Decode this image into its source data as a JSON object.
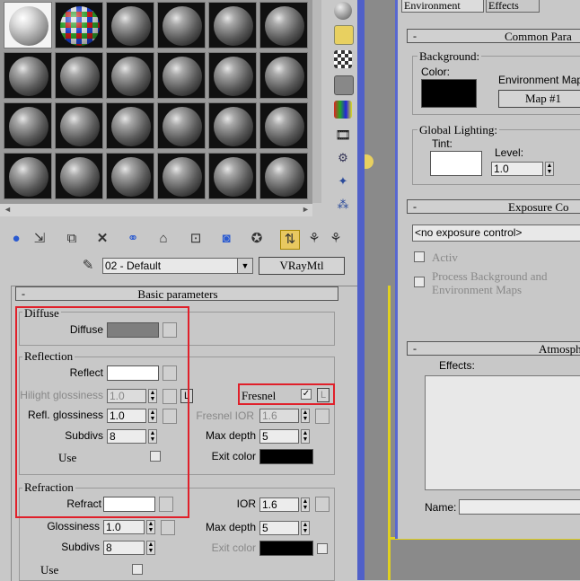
{
  "material_editor": {
    "toolbar_icons": [
      "get-material-icon",
      "put-to-scene-icon",
      "assign-material-icon",
      "delete-icon",
      "make-unique-icon",
      "put-to-library-icon",
      "material-effects-icon",
      "show-map-icon",
      "show-end-result-icon",
      "go-to-parent-icon",
      "go-sibling-icon"
    ],
    "side_icons": [
      "sample-type-icon",
      "backlight-icon",
      "checker-background-icon",
      "sample-uv-icon",
      "video-color-check-icon",
      "make-preview-icon",
      "options-icon",
      "select-by-material-icon",
      "material-navigator-icon"
    ],
    "material_name": "02 - Default",
    "material_type": "VRayMtl",
    "rollout_title": "Basic parameters",
    "diffuse": {
      "group": "Diffuse",
      "label": "Diffuse",
      "color": "#7e7e7e"
    },
    "reflection": {
      "group": "Reflection",
      "reflect_label": "Reflect",
      "reflect_color": "#ffffff",
      "hilight_label": "Hilight glossiness",
      "hilight_value": "1.0",
      "hilight_lock": "L",
      "refl_gloss_label": "Refl. glossiness",
      "refl_gloss_value": "1.0",
      "subdivs_label": "Subdivs",
      "subdivs_value": "8",
      "use_label": "Use",
      "fresnel_label": "Fresnel",
      "fresnel_checked": true,
      "fresnel_lock": "L",
      "fresnel_ior_label": "Fresnel IOR",
      "fresnel_ior_value": "1.6",
      "max_depth_label": "Max depth",
      "max_depth_value": "5",
      "exit_color_label": "Exit color",
      "exit_color": "#000000"
    },
    "refraction": {
      "group": "Refraction",
      "refract_label": "Refract",
      "refract_color": "#ffffff",
      "ior_label": "IOR",
      "ior_value": "1.6",
      "glossiness_label": "Glossiness",
      "glossiness_value": "1.0",
      "max_depth_label": "Max depth",
      "max_depth_value": "5",
      "subdivs_label": "Subdivs",
      "subdivs_value": "8",
      "exit_color_label": "Exit color",
      "exit_color": "#000000",
      "use_label": "Use"
    }
  },
  "environment": {
    "tabs": [
      "Environment",
      "Effects"
    ],
    "common_title": "Common Para",
    "background_label": "Background:",
    "color_label": "Color:",
    "background_color": "#000000",
    "env_map_label": "Environment Map",
    "map_button": "Map #1",
    "global_lighting_label": "Global Lighting:",
    "tint_label": "Tint:",
    "tint_color": "#ffffff",
    "level_label": "Level:",
    "level_value": "1.0",
    "exposure_title": "Exposure Co",
    "exposure_value": "<no exposure control>",
    "active_label": "Activ",
    "process_bg_label": "Process Background and Environment Maps",
    "atmos_title": "Atmosphe",
    "effects_label": "Effects:",
    "name_label": "Name:"
  },
  "accent": {
    "highlight_red": "#e0202a",
    "divider_blue": "#5060c8",
    "viewport_yellow": "#e0d020"
  }
}
